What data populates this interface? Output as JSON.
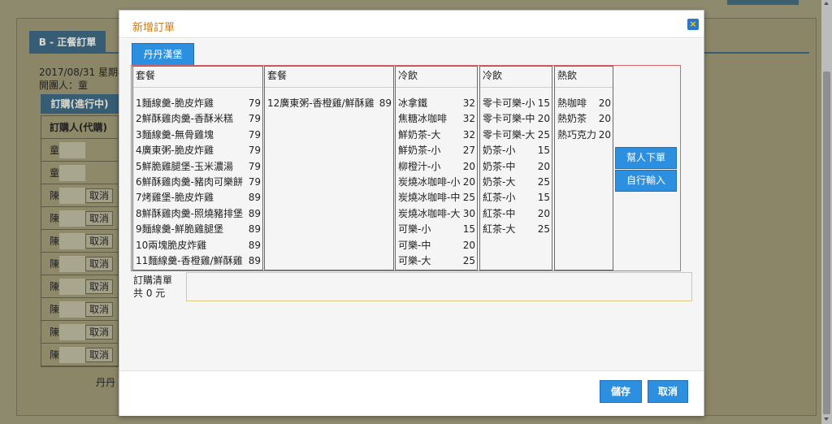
{
  "background": {
    "tab_label": "B - 正餐訂單",
    "date_text": "2017/08/31 星期4",
    "opener_text": "開團人：童",
    "section_label": "訂購(進行中)",
    "table_header": "訂購人(代購)",
    "rows": [
      {
        "name": "童",
        "has_cancel": false
      },
      {
        "name": "童",
        "has_cancel": false
      },
      {
        "name": "陳",
        "has_cancel": true
      },
      {
        "name": "陳",
        "has_cancel": true
      },
      {
        "name": "陳",
        "has_cancel": true
      },
      {
        "name": "陳",
        "has_cancel": true
      },
      {
        "name": "陳",
        "has_cancel": true
      },
      {
        "name": "陳",
        "has_cancel": true
      },
      {
        "name": "陳",
        "has_cancel": true
      },
      {
        "name": "陳",
        "has_cancel": true
      }
    ],
    "cancel_label": "取消",
    "footer_text": "丹丹"
  },
  "modal": {
    "title": "新增訂單",
    "close_icon": "×",
    "shop_button": "丹丹漢堡",
    "columns": [
      {
        "header": "套餐",
        "items": [
          {
            "name": "1麵線羹-脆皮炸雞",
            "price": "79"
          },
          {
            "name": "2鮮酥雞肉羹-香酥米糕",
            "price": "79"
          },
          {
            "name": "3麵線羹-無骨雞塊",
            "price": "79"
          },
          {
            "name": "4廣東粥-脆皮炸雞",
            "price": "79"
          },
          {
            "name": "5鮮脆雞腿堡-玉米濃湯",
            "price": "79"
          },
          {
            "name": "6鮮酥雞肉羹-豬肉可樂餅",
            "price": "79"
          },
          {
            "name": "7烤雞堡-脆皮炸雞",
            "price": "89"
          },
          {
            "name": "8鮮酥雞肉羹-照燒豬排堡",
            "price": "89"
          },
          {
            "name": "9麵線羹-鮮脆雞腿堡",
            "price": "89"
          },
          {
            "name": "10兩塊脆皮炸雞",
            "price": "89"
          },
          {
            "name": "11麵線羹-香橙雞/鮮酥雞",
            "price": "89"
          }
        ]
      },
      {
        "header": "套餐",
        "items": [
          {
            "name": "12廣東粥-香橙雞/鮮酥雞",
            "price": "89"
          }
        ]
      },
      {
        "header": "冷飲",
        "items": [
          {
            "name": "冰拿鐵",
            "price": "32"
          },
          {
            "name": "焦糖冰咖啡",
            "price": "32"
          },
          {
            "name": "鮮奶茶-大",
            "price": "32"
          },
          {
            "name": "鮮奶茶-小",
            "price": "27"
          },
          {
            "name": "柳橙汁-小",
            "price": "20"
          },
          {
            "name": "炭燒冰咖啡-小",
            "price": "20"
          },
          {
            "name": "炭燒冰咖啡-中",
            "price": "25"
          },
          {
            "name": "炭燒冰咖啡-大",
            "price": "30"
          },
          {
            "name": "可樂-小",
            "price": "15"
          },
          {
            "name": "可樂-中",
            "price": "20"
          },
          {
            "name": "可樂-大",
            "price": "25"
          }
        ]
      },
      {
        "header": "冷飲",
        "items": [
          {
            "name": "零卡可樂-小",
            "price": "15"
          },
          {
            "name": "零卡可樂-中",
            "price": "20"
          },
          {
            "name": "零卡可樂-大",
            "price": "25"
          },
          {
            "name": "奶茶-小",
            "price": "15"
          },
          {
            "name": "奶茶-中",
            "price": "20"
          },
          {
            "name": "奶茶-大",
            "price": "25"
          },
          {
            "name": "紅茶-小",
            "price": "15"
          },
          {
            "name": "紅茶-中",
            "price": "20"
          },
          {
            "name": "紅茶-大",
            "price": "25"
          }
        ]
      },
      {
        "header": "熱飲",
        "items": [
          {
            "name": "熱咖啡",
            "price": "20"
          },
          {
            "name": "熱奶茶",
            "price": "20"
          },
          {
            "name": "熱巧克力",
            "price": "20"
          }
        ]
      }
    ],
    "order_for_button": "幫人下單",
    "self_input_button": "自行輸入",
    "order_list_label": "訂購清單",
    "total_text": "共 0 元",
    "save_button": "儲存",
    "cancel_button": "取消"
  }
}
